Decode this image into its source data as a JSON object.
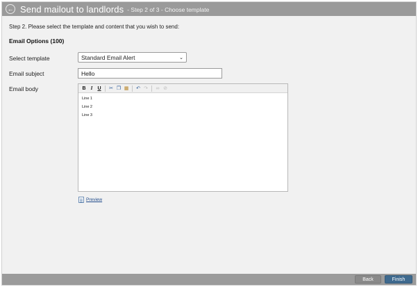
{
  "header": {
    "back_icon": "arrow-left-circle-icon",
    "title": "Send mailout to landlords",
    "subtitle": "- Step 2 of 3 - Choose template"
  },
  "instruction": "Step 2. Please select the template and content that you wish to send:",
  "section_heading": "Email Options (100)",
  "form": {
    "template_label": "Select template",
    "template_value": "Standard Email Alert",
    "subject_label": "Email subject",
    "subject_value": "Hello",
    "body_label": "Email body",
    "toolbar": {
      "bold": "B",
      "italic": "I",
      "underline": "U",
      "icons": [
        "cut-icon",
        "copy-icon",
        "paste-icon",
        "undo-icon",
        "redo-icon",
        "link-icon",
        "unlink-icon"
      ]
    },
    "body_lines": [
      "Line 1",
      "Line 2",
      "Line 3"
    ]
  },
  "preview_link": "Preview",
  "footer": {
    "back_label": "Back",
    "finish_label": "Finish",
    "accent": "#3f6a8f"
  }
}
